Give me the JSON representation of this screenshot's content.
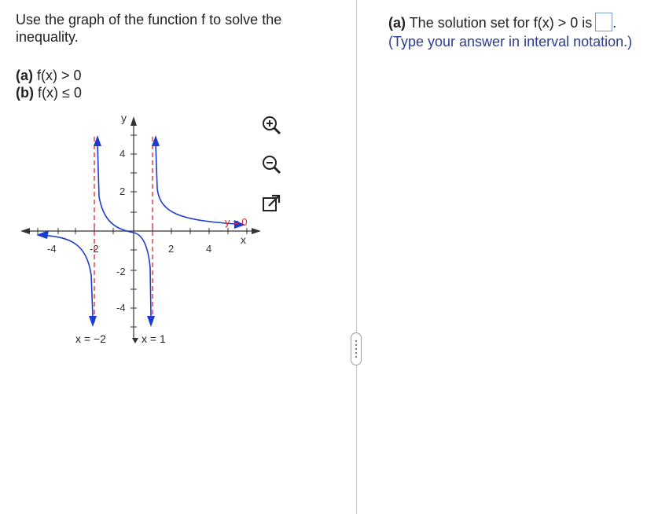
{
  "prompt": "Use the graph of the function f to solve the inequality.",
  "part_a_label": "(a)",
  "part_a_text": "f(x) > 0",
  "part_b_label": "(b)",
  "part_b_text": "f(x) ≤ 0",
  "graph": {
    "y_axis_label": "y",
    "x_axis_label": "x",
    "x_ticks": [
      "-4",
      "-2",
      "2",
      "4"
    ],
    "y_ticks": [
      "4",
      "2",
      "-2",
      "-4"
    ],
    "asymptote_left_label": "x = −2",
    "asymptote_right_label": "x = 1",
    "horizontal_asymptote_label": "y = 0",
    "curve_color": "#1a3ccf",
    "asymptote_color": "#e0262d",
    "icons": [
      "zoom-in-icon",
      "zoom-out-icon",
      "external-link-icon"
    ]
  },
  "answer": {
    "label": "(a)",
    "text": "The solution set for f(x) > 0 is",
    "end": ".",
    "hint": "(Type your answer in interval notation.)"
  }
}
